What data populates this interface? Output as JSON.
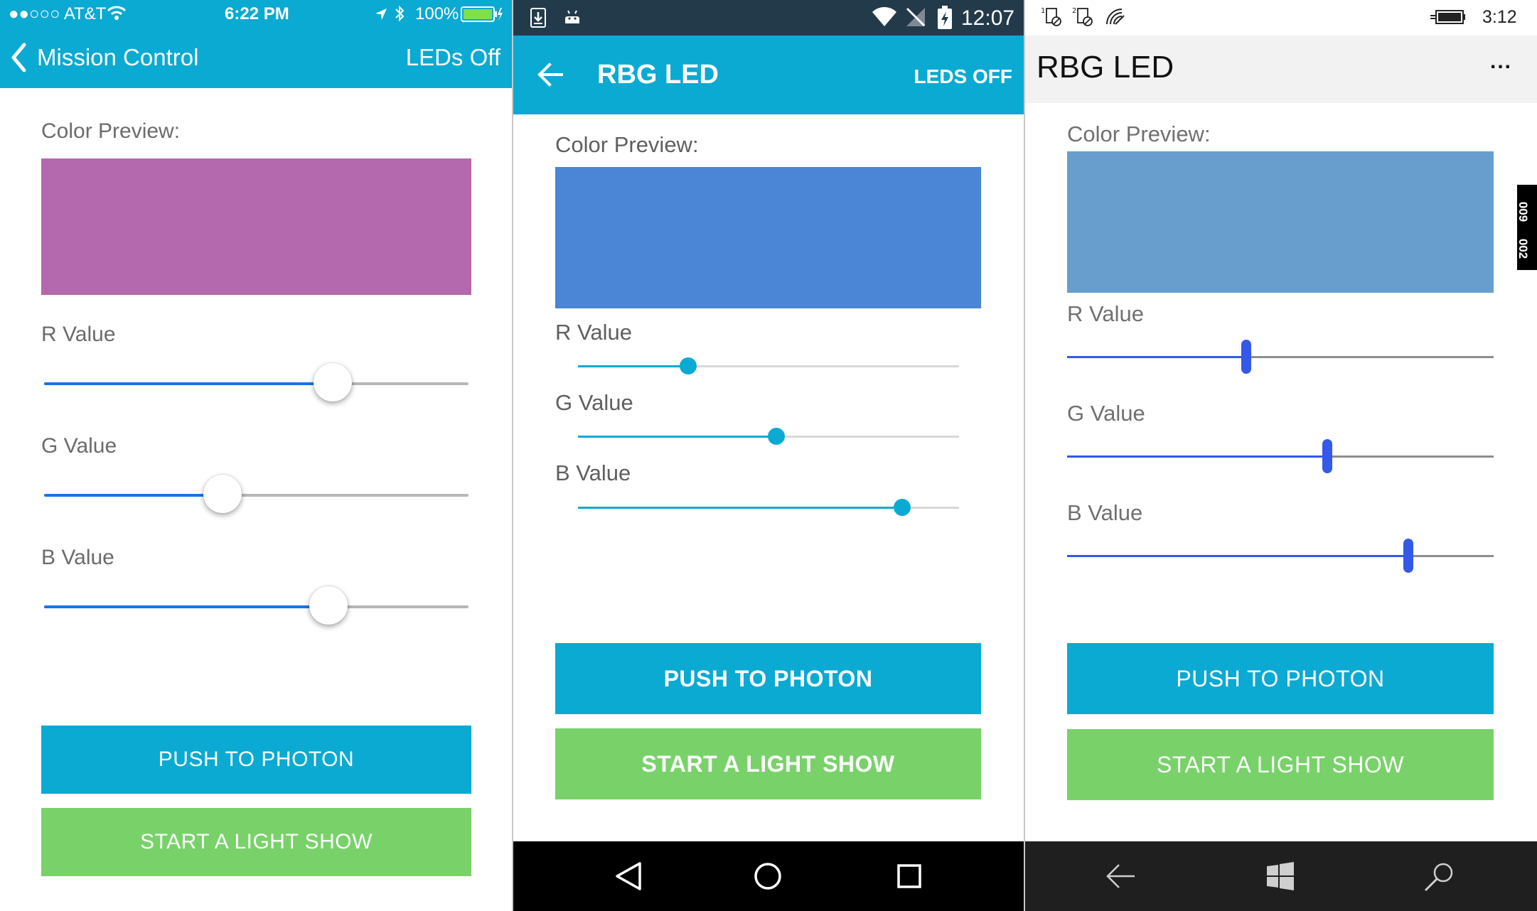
{
  "colors": {
    "ios_accent": "#0aaad2",
    "push_button": "#0aaad2",
    "light_show_button": "#78d269",
    "ios_preview": "#b468ae",
    "android_preview": "#4a85d6",
    "windows_preview": "#689ecd"
  },
  "ios": {
    "status": {
      "carrier": "●●○○○ AT&T",
      "time": "6:22 PM",
      "battery": "100%"
    },
    "nav": {
      "back_label": "Mission Control",
      "action_label": "LEDs Off"
    },
    "preview_label": "Color Preview:",
    "sliders": [
      {
        "label": "R Value",
        "value": 0.68
      },
      {
        "label": "G Value",
        "value": 0.42
      },
      {
        "label": "B Value",
        "value": 0.67
      }
    ],
    "push_button": "PUSH TO PHOTON",
    "light_show_button": "START A LIGHT SHOW"
  },
  "android": {
    "status": {
      "time": "12:07"
    },
    "appbar": {
      "title": "RBG LED",
      "action_label": "LEDS OFF"
    },
    "preview_label": "Color Preview:",
    "sliders": [
      {
        "label": "R Value",
        "value": 0.29
      },
      {
        "label": "G Value",
        "value": 0.52
      },
      {
        "label": "B Value",
        "value": 0.85
      }
    ],
    "push_button": "PUSH TO PHOTON",
    "light_show_button": "START A LIGHT SHOW"
  },
  "windows": {
    "status": {
      "time": "3:12",
      "tag_top": "009",
      "tag_bottom": "002"
    },
    "title": "RBG LED",
    "more_label": "...",
    "preview_label": "Color Preview:",
    "sliders": [
      {
        "label": "R Value",
        "value": 0.42
      },
      {
        "label": "G Value",
        "value": 0.61
      },
      {
        "label": "B Value",
        "value": 0.8
      }
    ],
    "push_button": "PUSH TO PHOTON",
    "light_show_button": "START A LIGHT SHOW"
  }
}
